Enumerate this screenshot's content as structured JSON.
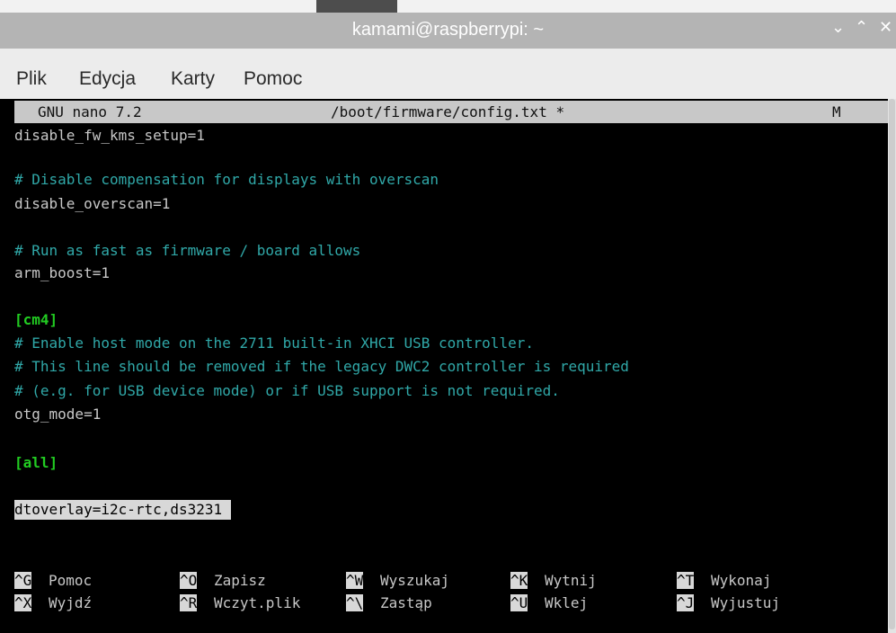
{
  "window": {
    "title": "kamami@raspberrypi: ~",
    "controls": {
      "minimize": "⌄",
      "maximize": "⌃",
      "close": "✕"
    }
  },
  "menu": {
    "items": [
      "Plik",
      "Edycja",
      "Karty",
      "Pomoc"
    ]
  },
  "nano": {
    "version_label": "GNU nano 7.2",
    "filename": "/boot/firmware/config.txt *",
    "modified_flag": "M"
  },
  "lines": [
    {
      "text": "disable_fw_kms_setup=1",
      "kind": "plain"
    },
    {
      "text": "",
      "kind": "plain"
    },
    {
      "text": "# Disable compensation for displays with overscan",
      "kind": "comment"
    },
    {
      "text": "disable_overscan=1",
      "kind": "plain"
    },
    {
      "text": "",
      "kind": "plain"
    },
    {
      "text": "# Run as fast as firmware / board allows",
      "kind": "comment"
    },
    {
      "text": "arm_boost=1",
      "kind": "plain"
    },
    {
      "text": "",
      "kind": "plain"
    },
    {
      "text": "[cm4]",
      "kind": "section"
    },
    {
      "text": "# Enable host mode on the 2711 built-in XHCI USB controller.",
      "kind": "comment"
    },
    {
      "text": "# This line should be removed if the legacy DWC2 controller is required",
      "kind": "comment"
    },
    {
      "text": "# (e.g. for USB device mode) or if USB support is not required.",
      "kind": "comment"
    },
    {
      "text": "otg_mode=1",
      "kind": "plain"
    },
    {
      "text": "",
      "kind": "plain"
    },
    {
      "text": "[all]",
      "kind": "section"
    },
    {
      "text": "",
      "kind": "plain"
    },
    {
      "text": "dtoverlay=i2c-rtc,ds3231",
      "kind": "selected"
    }
  ],
  "shortcuts": {
    "row1": [
      {
        "key": "^G",
        "label": "Pomoc"
      },
      {
        "key": "^O",
        "label": "Zapisz"
      },
      {
        "key": "^W",
        "label": "Wyszukaj"
      },
      {
        "key": "^K",
        "label": "Wytnij"
      },
      {
        "key": "^T",
        "label": "Wykonaj"
      }
    ],
    "row2": [
      {
        "key": "^X",
        "label": "Wyjdź"
      },
      {
        "key": "^R",
        "label": "Wczyt.plik"
      },
      {
        "key": "^\\",
        "label": "Zastąp"
      },
      {
        "key": "^U",
        "label": "Wklej"
      },
      {
        "key": "^J",
        "label": "Wyjustuj"
      }
    ]
  },
  "colors": {
    "comment": "#30a8a8",
    "section": "#22cc22",
    "text": "#c8c8c8",
    "titlebar": "#b4b4b4"
  }
}
